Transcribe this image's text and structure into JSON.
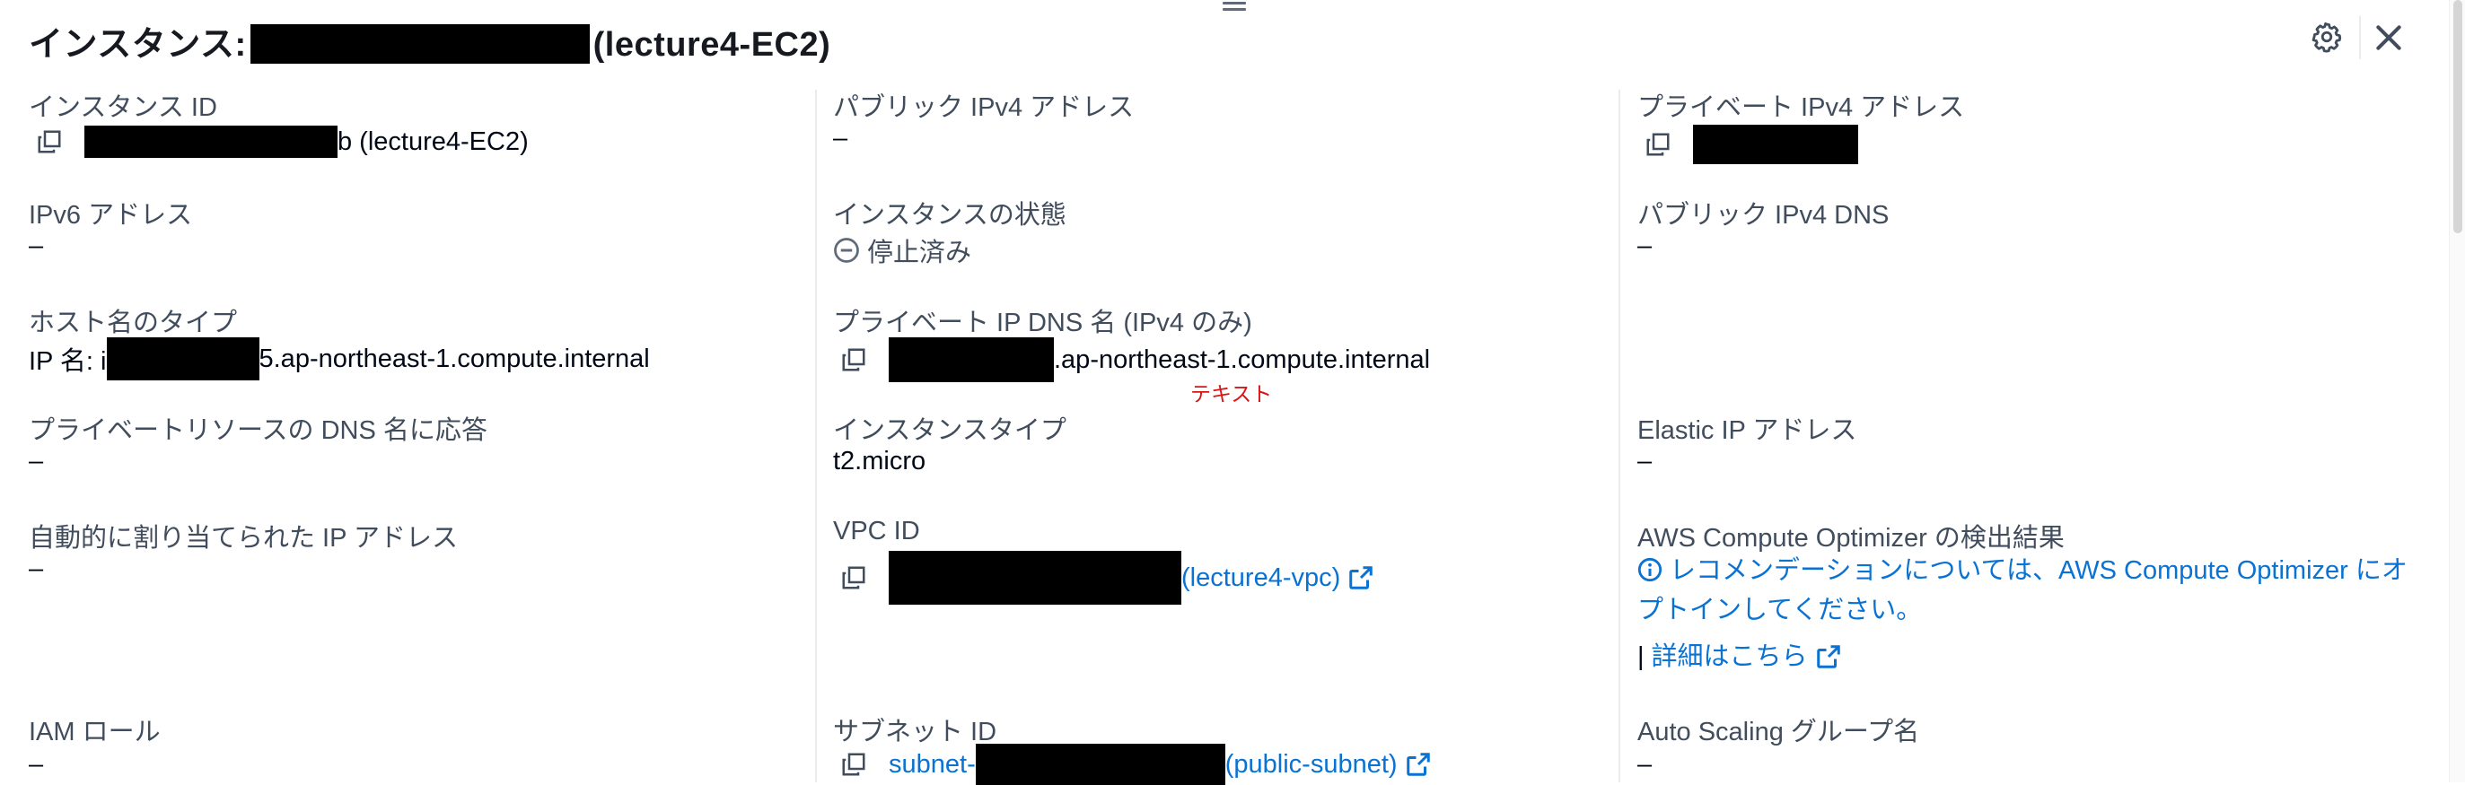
{
  "header": {
    "title_prefix": "インスタンス:",
    "title_suffix": "(lecture4-EC2)",
    "settings_icon": "gear-icon",
    "close_icon": "close-icon"
  },
  "col1": {
    "instance_id": {
      "label": "インスタンス ID",
      "suffix": "b (lecture4-EC2)"
    },
    "ipv6": {
      "label": "IPv6 アドレス",
      "value": "–"
    },
    "hostname_type": {
      "label": "ホスト名のタイプ",
      "prefix": "IP 名: i",
      "suffix": "5.ap-northeast-1.compute.internal"
    },
    "private_dns_answer": {
      "label": "プライベートリソースの DNS 名に応答",
      "value": "–"
    },
    "auto_ip": {
      "label": "自動的に割り当てられた IP アドレス",
      "value": "–"
    },
    "iam_role": {
      "label": "IAM ロール",
      "value": "–"
    }
  },
  "col2": {
    "public_ipv4": {
      "label": "パブリック IPv4 アドレス",
      "value": "–"
    },
    "instance_state": {
      "label": "インスタンスの状態",
      "value": "停止済み"
    },
    "private_ip_dns": {
      "label": "プライベート IP DNS 名 (IPv4 のみ)",
      "suffix": ".ap-northeast-1.compute.internal",
      "note": "テキスト"
    },
    "instance_type": {
      "label": "インスタンスタイプ",
      "value": "t2.micro"
    },
    "vpc_id": {
      "label": "VPC ID",
      "link_suffix": "(lecture4-vpc)"
    },
    "subnet_id": {
      "label": "サブネット ID",
      "link_prefix": "subnet-",
      "link_suffix": "(public-subnet)"
    }
  },
  "col3": {
    "private_ipv4": {
      "label": "プライベート IPv4 アドレス"
    },
    "public_ipv4_dns": {
      "label": "パブリック IPv4 DNS",
      "value": "–"
    },
    "elastic_ip": {
      "label": "Elastic IP アドレス",
      "value": "–"
    },
    "optimizer": {
      "label": "AWS Compute Optimizer の検出結果",
      "line1": "レコメンデーションについては、AWS Compute Optimizer にオ",
      "line2": "プトインしてください。",
      "detail_link": "詳細はこちら"
    },
    "auto_scaling": {
      "label": "Auto Scaling グループ名",
      "value": "–"
    }
  },
  "colors": {
    "link": "#0972d3",
    "label": "#414d5c",
    "note": "#d91515"
  }
}
